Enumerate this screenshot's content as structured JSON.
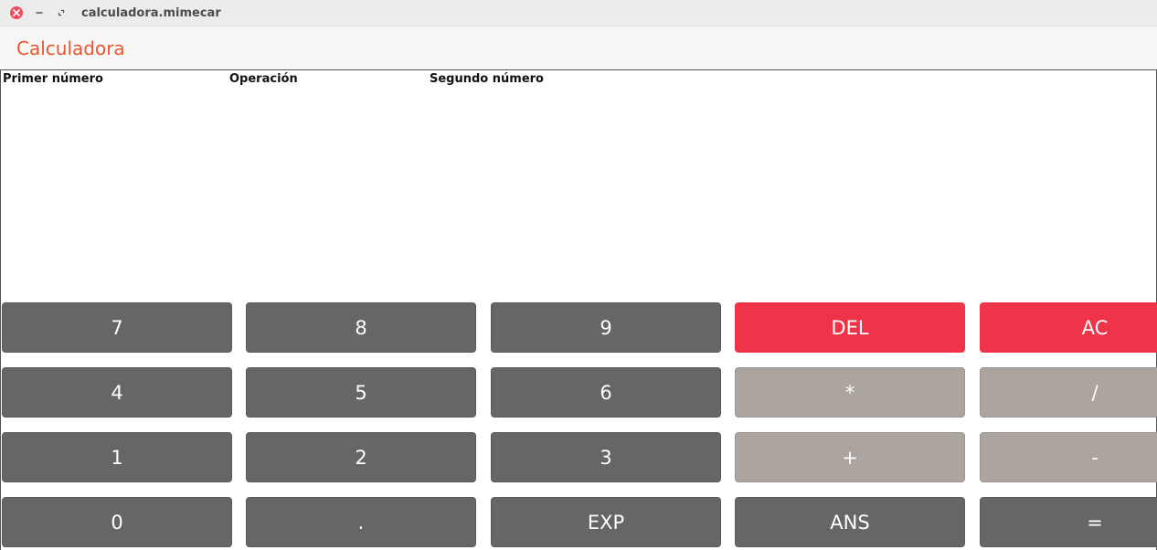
{
  "window": {
    "title": "calculadora.mimecar",
    "controls": {
      "close_icon": "close-icon",
      "minimize_icon": "minimize-icon",
      "maximize_icon": "maximize-icon"
    }
  },
  "header": {
    "title": "Calculadora",
    "title_color": "#e8572d"
  },
  "display": {
    "first_number_label": "Primer número",
    "operation_label": "Operación",
    "second_number_label": "Segundo número",
    "first_number_value": "",
    "operation_value": "",
    "second_number_value": ""
  },
  "keypad": {
    "colors": {
      "dark": "#666666",
      "red": "#ef3349",
      "light": "#aca59f"
    },
    "rows": [
      [
        {
          "label": "7",
          "style": "dark"
        },
        {
          "label": "8",
          "style": "dark"
        },
        {
          "label": "9",
          "style": "dark"
        },
        {
          "label": "DEL",
          "style": "red"
        },
        {
          "label": "AC",
          "style": "red"
        }
      ],
      [
        {
          "label": "4",
          "style": "dark"
        },
        {
          "label": "5",
          "style": "dark"
        },
        {
          "label": "6",
          "style": "dark"
        },
        {
          "label": "*",
          "style": "light"
        },
        {
          "label": "/",
          "style": "light"
        }
      ],
      [
        {
          "label": "1",
          "style": "dark"
        },
        {
          "label": "2",
          "style": "dark"
        },
        {
          "label": "3",
          "style": "dark"
        },
        {
          "label": "+",
          "style": "light"
        },
        {
          "label": "-",
          "style": "light"
        }
      ],
      [
        {
          "label": "0",
          "style": "dark"
        },
        {
          "label": ".",
          "style": "dark"
        },
        {
          "label": "EXP",
          "style": "dark"
        },
        {
          "label": "ANS",
          "style": "dark"
        },
        {
          "label": "=",
          "style": "dark"
        }
      ]
    ]
  }
}
